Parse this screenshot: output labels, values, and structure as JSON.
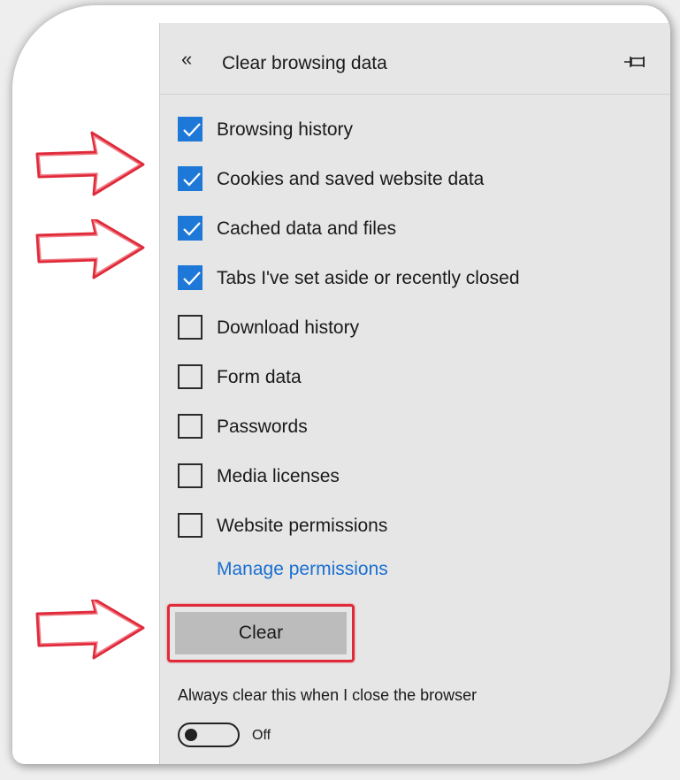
{
  "panel": {
    "title": "Clear browsing data",
    "back_icon": "double-chevron-left-icon",
    "pin_icon": "pin-icon"
  },
  "options": [
    {
      "label": "Browsing history",
      "checked": true
    },
    {
      "label": "Cookies and saved website data",
      "checked": true
    },
    {
      "label": "Cached data and files",
      "checked": true
    },
    {
      "label": "Tabs I've set aside or recently closed",
      "checked": true
    },
    {
      "label": "Download history",
      "checked": false
    },
    {
      "label": "Form data",
      "checked": false
    },
    {
      "label": "Passwords",
      "checked": false
    },
    {
      "label": "Media licenses",
      "checked": false
    },
    {
      "label": "Website permissions",
      "checked": false
    }
  ],
  "manage_link": "Manage permissions",
  "clear_button": "Clear",
  "always_clear": {
    "label": "Always clear this when I close the browser",
    "state": "Off"
  },
  "colors": {
    "accent": "#1e78d7",
    "link": "#1a6fd0",
    "annotation_red": "#e02a3a"
  }
}
